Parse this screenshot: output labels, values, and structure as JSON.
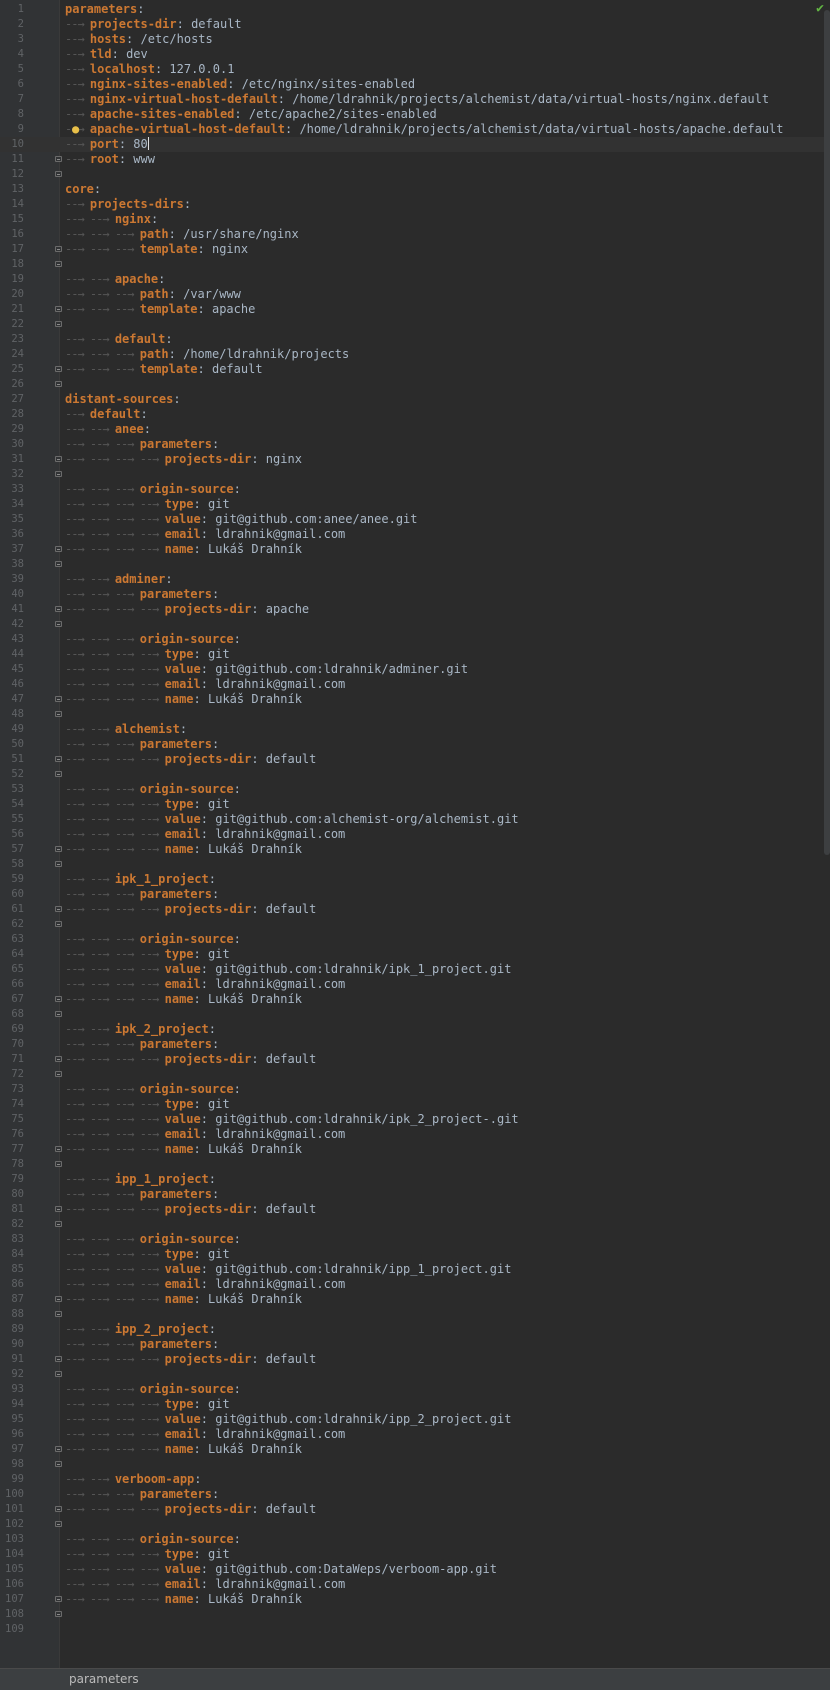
{
  "editor": {
    "language": "yaml",
    "current_line": 10,
    "caret_after_line_text": true,
    "lines": [
      {
        "n": "1",
        "d": 0,
        "k": "parameters",
        "v": ""
      },
      {
        "n": "2",
        "d": 1,
        "k": "projects-dir",
        "v": "default"
      },
      {
        "n": "3",
        "d": 1,
        "k": "hosts",
        "v": "/etc/hosts"
      },
      {
        "n": "4",
        "d": 1,
        "k": "tld",
        "v": "dev"
      },
      {
        "n": "5",
        "d": 1,
        "k": "localhost",
        "v": "127.0.0.1"
      },
      {
        "n": "6",
        "d": 1,
        "k": "nginx-sites-enabled",
        "v": "/etc/nginx/sites-enabled"
      },
      {
        "n": "7",
        "d": 1,
        "k": "nginx-virtual-host-default",
        "v": "/home/ldrahnik/projects/alchemist/data/virtual-hosts/nginx.default"
      },
      {
        "n": "8",
        "d": 1,
        "k": "apache-sites-enabled",
        "v": "/etc/apache2/sites-enabled"
      },
      {
        "n": "9",
        "d": 1,
        "k": "apache-virtual-host-default",
        "v": "/home/ldrahnik/projects/alchemist/data/virtual-hosts/apache.default"
      },
      {
        "n": "10",
        "d": 1,
        "k": "port",
        "v": "80"
      },
      {
        "n": "11",
        "d": 1,
        "k": "root",
        "v": "www"
      },
      {
        "n": "12",
        "d": 0,
        "k": "",
        "v": ""
      },
      {
        "n": "13",
        "d": 0,
        "k": "core",
        "v": ""
      },
      {
        "n": "14",
        "d": 1,
        "k": "projects-dirs",
        "v": ""
      },
      {
        "n": "15",
        "d": 2,
        "k": "nginx",
        "v": ""
      },
      {
        "n": "16",
        "d": 3,
        "k": "path",
        "v": "/usr/share/nginx"
      },
      {
        "n": "17",
        "d": 3,
        "k": "template",
        "v": "nginx"
      },
      {
        "n": "18",
        "d": 0,
        "k": "",
        "v": ""
      },
      {
        "n": "19",
        "d": 2,
        "k": "apache",
        "v": ""
      },
      {
        "n": "20",
        "d": 3,
        "k": "path",
        "v": "/var/www"
      },
      {
        "n": "21",
        "d": 3,
        "k": "template",
        "v": "apache"
      },
      {
        "n": "22",
        "d": 0,
        "k": "",
        "v": ""
      },
      {
        "n": "23",
        "d": 2,
        "k": "default",
        "v": ""
      },
      {
        "n": "24",
        "d": 3,
        "k": "path",
        "v": "/home/ldrahnik/projects"
      },
      {
        "n": "25",
        "d": 3,
        "k": "template",
        "v": "default"
      },
      {
        "n": "26",
        "d": 0,
        "k": "",
        "v": ""
      },
      {
        "n": "27",
        "d": 0,
        "k": "distant-sources",
        "v": ""
      },
      {
        "n": "28",
        "d": 1,
        "k": "default",
        "v": ""
      },
      {
        "n": "29",
        "d": 2,
        "k": "anee",
        "v": ""
      },
      {
        "n": "30",
        "d": 3,
        "k": "parameters",
        "v": ""
      },
      {
        "n": "31",
        "d": 4,
        "k": "projects-dir",
        "v": "nginx"
      },
      {
        "n": "32",
        "d": 0,
        "k": "",
        "v": ""
      },
      {
        "n": "33",
        "d": 3,
        "k": "origin-source",
        "v": ""
      },
      {
        "n": "34",
        "d": 4,
        "k": "type",
        "v": "git"
      },
      {
        "n": "35",
        "d": 4,
        "k": "value",
        "v": "git@github.com:anee/anee.git"
      },
      {
        "n": "36",
        "d": 4,
        "k": "email",
        "v": "ldrahnik@gmail.com"
      },
      {
        "n": "37",
        "d": 4,
        "k": "name",
        "v": "Lukáš Drahník"
      },
      {
        "n": "38",
        "d": 0,
        "k": "",
        "v": ""
      },
      {
        "n": "39",
        "d": 2,
        "k": "adminer",
        "v": ""
      },
      {
        "n": "40",
        "d": 3,
        "k": "parameters",
        "v": ""
      },
      {
        "n": "41",
        "d": 4,
        "k": "projects-dir",
        "v": "apache"
      },
      {
        "n": "42",
        "d": 0,
        "k": "",
        "v": ""
      },
      {
        "n": "43",
        "d": 3,
        "k": "origin-source",
        "v": ""
      },
      {
        "n": "44",
        "d": 4,
        "k": "type",
        "v": "git"
      },
      {
        "n": "45",
        "d": 4,
        "k": "value",
        "v": "git@github.com:ldrahnik/adminer.git"
      },
      {
        "n": "46",
        "d": 4,
        "k": "email",
        "v": "ldrahnik@gmail.com"
      },
      {
        "n": "47",
        "d": 4,
        "k": "name",
        "v": "Lukáš Drahník"
      },
      {
        "n": "48",
        "d": 0,
        "k": "",
        "v": ""
      },
      {
        "n": "49",
        "d": 2,
        "k": "alchemist",
        "v": ""
      },
      {
        "n": "50",
        "d": 3,
        "k": "parameters",
        "v": ""
      },
      {
        "n": "51",
        "d": 4,
        "k": "projects-dir",
        "v": "default"
      },
      {
        "n": "52",
        "d": 0,
        "k": "",
        "v": ""
      },
      {
        "n": "53",
        "d": 3,
        "k": "origin-source",
        "v": ""
      },
      {
        "n": "54",
        "d": 4,
        "k": "type",
        "v": "git"
      },
      {
        "n": "55",
        "d": 4,
        "k": "value",
        "v": "git@github.com:alchemist-org/alchemist.git"
      },
      {
        "n": "56",
        "d": 4,
        "k": "email",
        "v": "ldrahnik@gmail.com"
      },
      {
        "n": "57",
        "d": 4,
        "k": "name",
        "v": "Lukáš Drahník"
      },
      {
        "n": "58",
        "d": 0,
        "k": "",
        "v": ""
      },
      {
        "n": "59",
        "d": 2,
        "k": "ipk_1_project",
        "v": ""
      },
      {
        "n": "60",
        "d": 3,
        "k": "parameters",
        "v": ""
      },
      {
        "n": "61",
        "d": 4,
        "k": "projects-dir",
        "v": "default"
      },
      {
        "n": "62",
        "d": 0,
        "k": "",
        "v": ""
      },
      {
        "n": "63",
        "d": 3,
        "k": "origin-source",
        "v": ""
      },
      {
        "n": "64",
        "d": 4,
        "k": "type",
        "v": "git"
      },
      {
        "n": "65",
        "d": 4,
        "k": "value",
        "v": "git@github.com:ldrahnik/ipk_1_project.git"
      },
      {
        "n": "66",
        "d": 4,
        "k": "email",
        "v": "ldrahnik@gmail.com"
      },
      {
        "n": "67",
        "d": 4,
        "k": "name",
        "v": "Lukáš Drahník"
      },
      {
        "n": "68",
        "d": 0,
        "k": "",
        "v": ""
      },
      {
        "n": "69",
        "d": 2,
        "k": "ipk_2_project",
        "v": ""
      },
      {
        "n": "70",
        "d": 3,
        "k": "parameters",
        "v": ""
      },
      {
        "n": "71",
        "d": 4,
        "k": "projects-dir",
        "v": "default"
      },
      {
        "n": "72",
        "d": 0,
        "k": "",
        "v": ""
      },
      {
        "n": "73",
        "d": 3,
        "k": "origin-source",
        "v": ""
      },
      {
        "n": "74",
        "d": 4,
        "k": "type",
        "v": "git"
      },
      {
        "n": "75",
        "d": 4,
        "k": "value",
        "v": "git@github.com:ldrahnik/ipk_2_project-.git"
      },
      {
        "n": "76",
        "d": 4,
        "k": "email",
        "v": "ldrahnik@gmail.com"
      },
      {
        "n": "77",
        "d": 4,
        "k": "name",
        "v": "Lukáš Drahník"
      },
      {
        "n": "78",
        "d": 0,
        "k": "",
        "v": ""
      },
      {
        "n": "79",
        "d": 2,
        "k": "ipp_1_project",
        "v": ""
      },
      {
        "n": "80",
        "d": 3,
        "k": "parameters",
        "v": ""
      },
      {
        "n": "81",
        "d": 4,
        "k": "projects-dir",
        "v": "default"
      },
      {
        "n": "82",
        "d": 0,
        "k": "",
        "v": ""
      },
      {
        "n": "83",
        "d": 3,
        "k": "origin-source",
        "v": ""
      },
      {
        "n": "84",
        "d": 4,
        "k": "type",
        "v": "git"
      },
      {
        "n": "85",
        "d": 4,
        "k": "value",
        "v": "git@github.com:ldrahnik/ipp_1_project.git"
      },
      {
        "n": "86",
        "d": 4,
        "k": "email",
        "v": "ldrahnik@gmail.com"
      },
      {
        "n": "87",
        "d": 4,
        "k": "name",
        "v": "Lukáš Drahník"
      },
      {
        "n": "88",
        "d": 0,
        "k": "",
        "v": ""
      },
      {
        "n": "89",
        "d": 2,
        "k": "ipp_2_project",
        "v": ""
      },
      {
        "n": "90",
        "d": 3,
        "k": "parameters",
        "v": ""
      },
      {
        "n": "91",
        "d": 4,
        "k": "projects-dir",
        "v": "default"
      },
      {
        "n": "92",
        "d": 0,
        "k": "",
        "v": ""
      },
      {
        "n": "93",
        "d": 3,
        "k": "origin-source",
        "v": ""
      },
      {
        "n": "94",
        "d": 4,
        "k": "type",
        "v": "git"
      },
      {
        "n": "95",
        "d": 4,
        "k": "value",
        "v": "git@github.com:ldrahnik/ipp_2_project.git"
      },
      {
        "n": "96",
        "d": 4,
        "k": "email",
        "v": "ldrahnik@gmail.com"
      },
      {
        "n": "97",
        "d": 4,
        "k": "name",
        "v": "Lukáš Drahník"
      },
      {
        "n": "98",
        "d": 0,
        "k": "",
        "v": ""
      },
      {
        "n": "99",
        "d": 2,
        "k": "verboom-app",
        "v": ""
      },
      {
        "n": "100",
        "d": 3,
        "k": "parameters",
        "v": ""
      },
      {
        "n": "101",
        "d": 4,
        "k": "projects-dir",
        "v": "default"
      },
      {
        "n": "102",
        "d": 0,
        "k": "",
        "v": ""
      },
      {
        "n": "103",
        "d": 3,
        "k": "origin-source",
        "v": ""
      },
      {
        "n": "104",
        "d": 4,
        "k": "type",
        "v": "git"
      },
      {
        "n": "105",
        "d": 4,
        "k": "value",
        "v": "git@github.com:DataWeps/verboom-app.git"
      },
      {
        "n": "106",
        "d": 4,
        "k": "email",
        "v": "ldrahnik@gmail.com"
      },
      {
        "n": "107",
        "d": 4,
        "k": "name",
        "v": "Lukáš Drahník"
      },
      {
        "n": "108",
        "d": 0,
        "k": "",
        "v": ""
      },
      {
        "n": "109",
        "d": 0,
        "k": "",
        "v": ""
      }
    ],
    "fold_markers": [
      "11",
      "12",
      "17",
      "18",
      "21",
      "22",
      "25",
      "26",
      "31",
      "32",
      "37",
      "38",
      "41",
      "42",
      "47",
      "48",
      "51",
      "52",
      "57",
      "58",
      "61",
      "62",
      "67",
      "68",
      "71",
      "72",
      "77",
      "78",
      "81",
      "82",
      "87",
      "88",
      "91",
      "92",
      "97",
      "98",
      "101",
      "102",
      "107",
      "108"
    ],
    "intention_bulb_line": "9",
    "inspection_status_icon": "checkmark-icon"
  },
  "status_bar": {
    "breadcrumb": "parameters"
  },
  "colors": {
    "background": "#2b2b2b",
    "gutter": "#313335",
    "key": "#cc7832",
    "value": "#a9b7c6",
    "line_number": "#606366",
    "check": "#62b543"
  }
}
